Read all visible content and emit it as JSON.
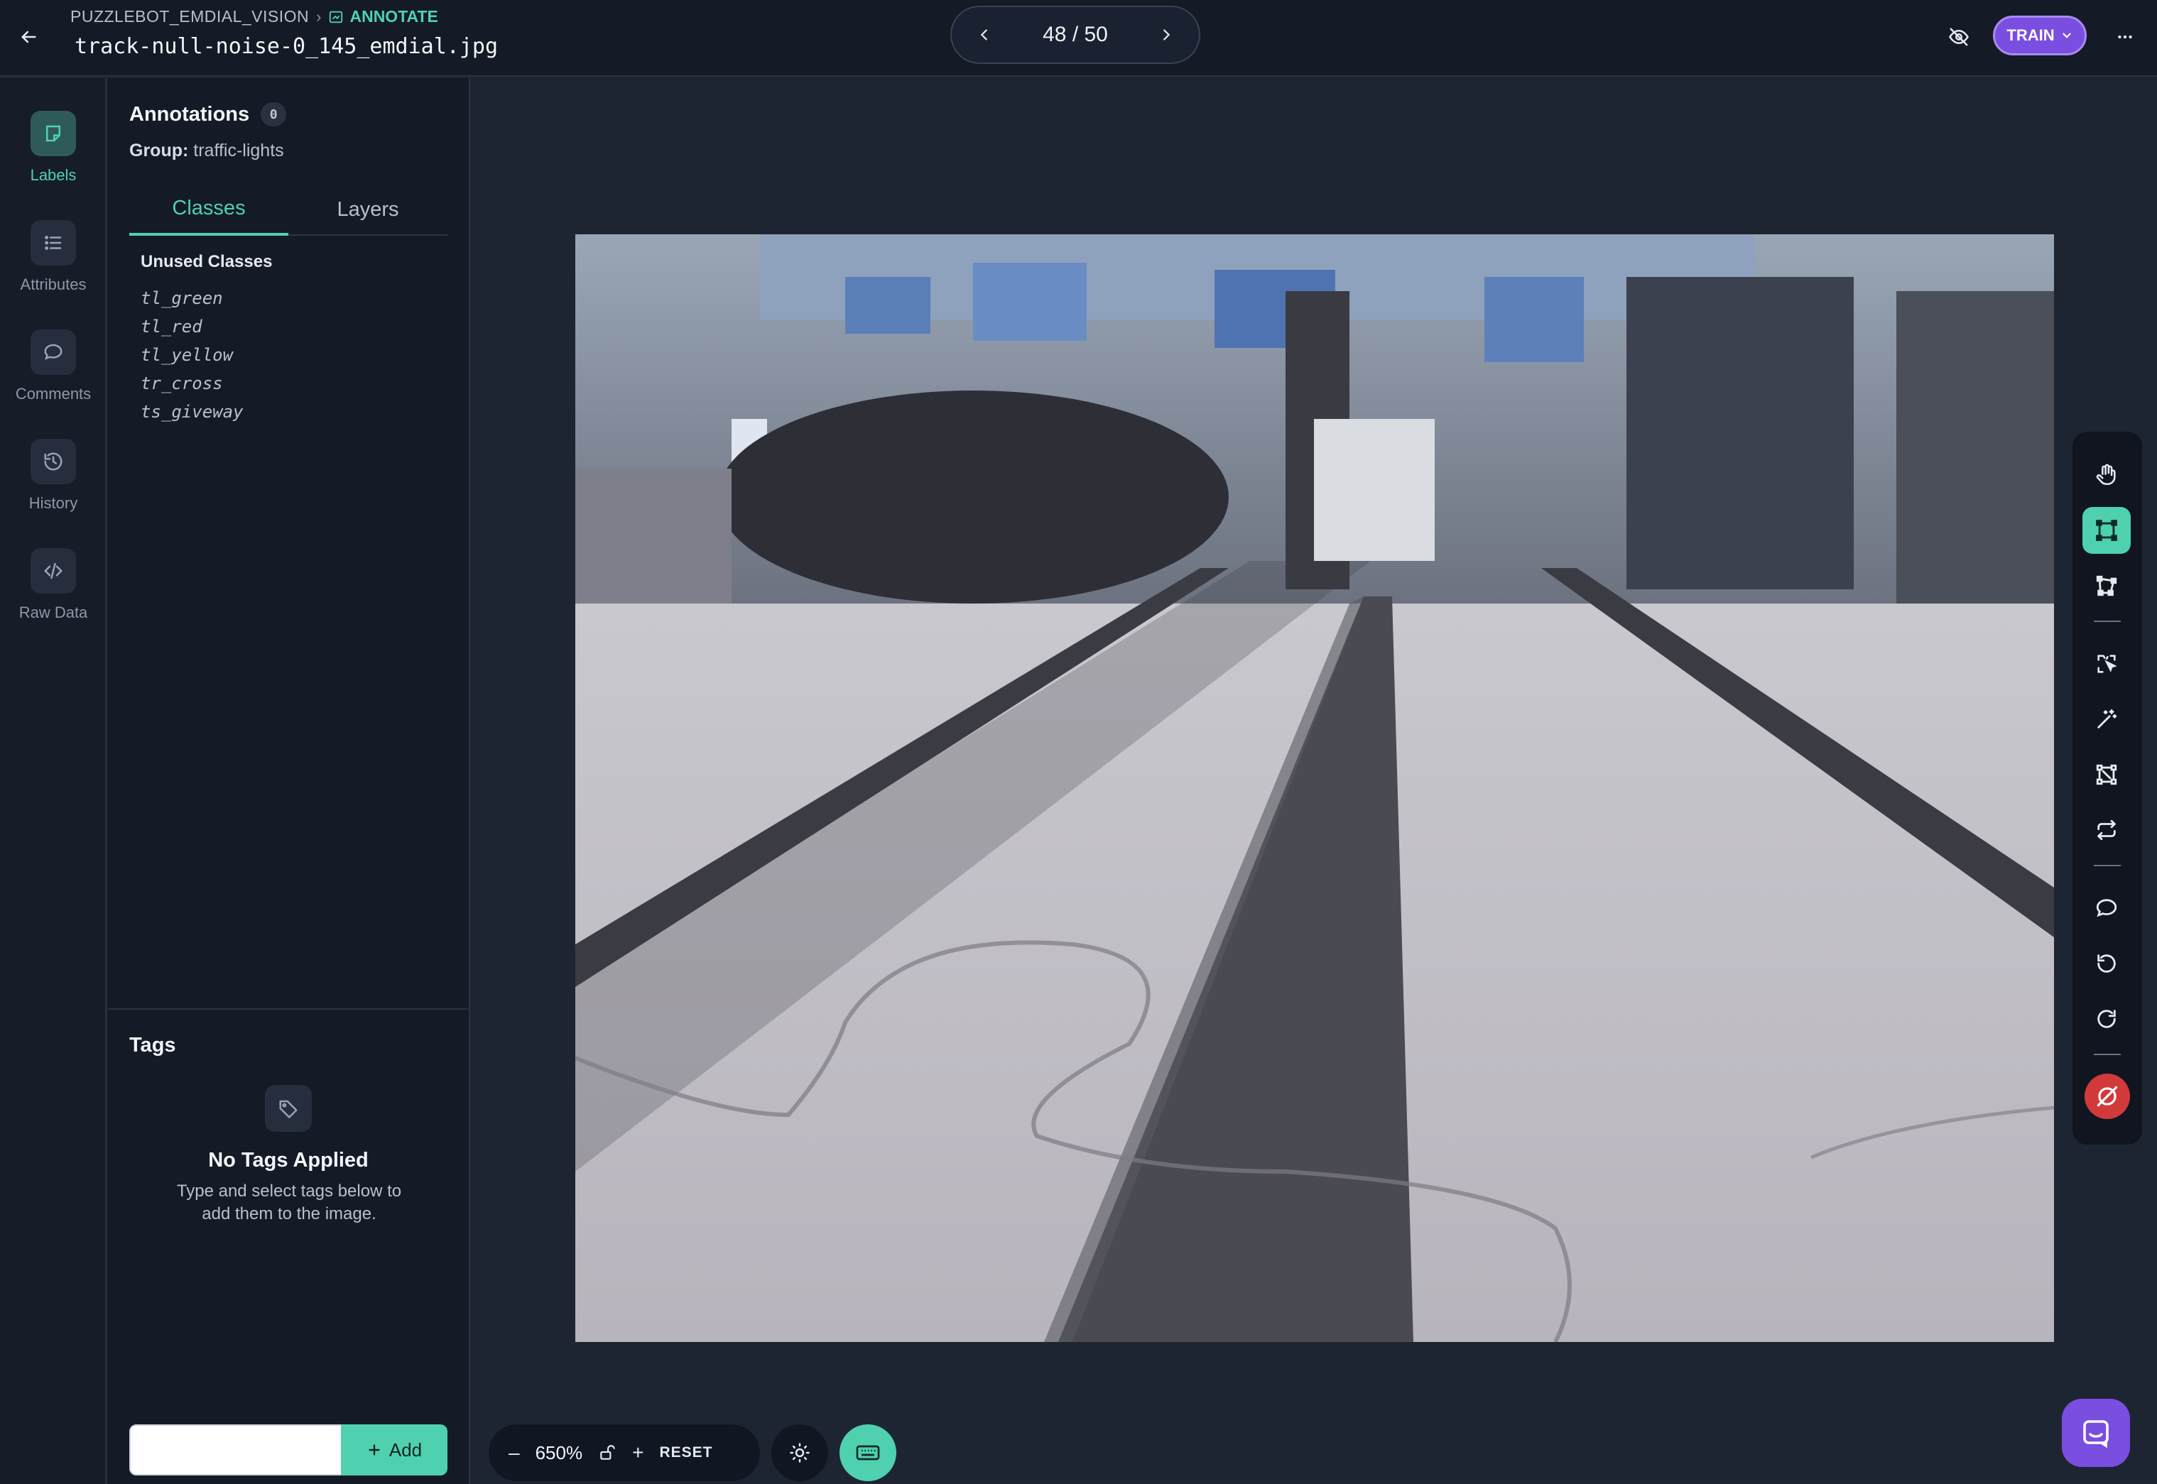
{
  "header": {
    "project": "PUZZLEBOT_EMDIAL_VISION",
    "mode": "ANNOTATE",
    "filename": "track-null-noise-0_145_emdial.jpg",
    "pager": "48 / 50",
    "train_label": "TRAIN"
  },
  "rail": {
    "items": [
      {
        "label": "Labels",
        "icon": "labels-icon"
      },
      {
        "label": "Attributes",
        "icon": "attributes-icon"
      },
      {
        "label": "Comments",
        "icon": "comments-icon"
      },
      {
        "label": "History",
        "icon": "history-icon"
      },
      {
        "label": "Raw Data",
        "icon": "code-icon"
      }
    ]
  },
  "annotations": {
    "title": "Annotations",
    "count": "0",
    "group_label": "Group:",
    "group_value": "traffic-lights",
    "tabs": [
      "Classes",
      "Layers"
    ],
    "unused_title": "Unused Classes",
    "classes": [
      "tl_green",
      "tl_red",
      "tl_yellow",
      "tr_cross",
      "ts_giveway"
    ]
  },
  "tags": {
    "title": "Tags",
    "empty_title": "No Tags Applied",
    "empty_desc": "Type and select tags below to add them to the image.",
    "input_value": "",
    "add_label": "Add"
  },
  "zoom": {
    "minus": "–",
    "value": "650%",
    "plus": "+",
    "reset": "RESET"
  },
  "colors": {
    "accent": "#4fd1b0",
    "brand_purple": "#7a4ee0",
    "danger": "#d23a3a",
    "background": "#1e2532"
  }
}
